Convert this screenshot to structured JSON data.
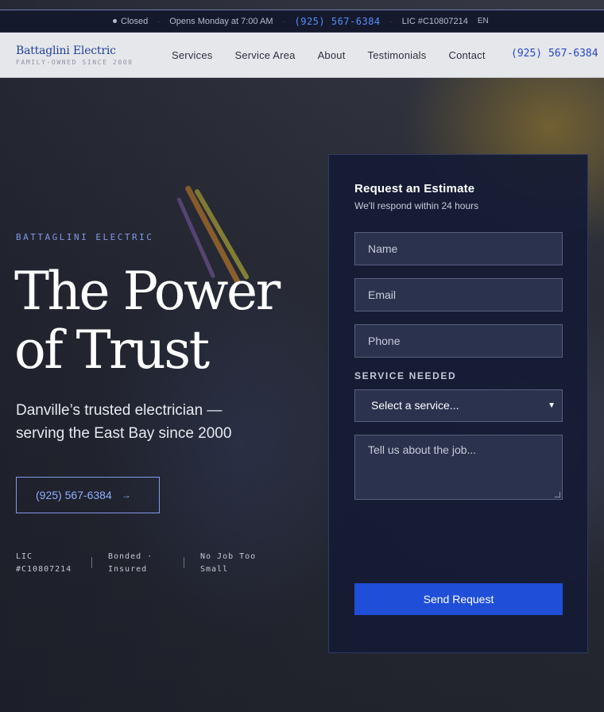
{
  "topbar": {
    "status": "Closed",
    "hours": "Opens Monday at 7:00 AM",
    "phone": "(925) 567-6384",
    "license": "LIC #C10807214",
    "language": "EN"
  },
  "nav": {
    "brand_name": "Battaglini Electric",
    "brand_tagline": "FAMILY-OWNED SINCE 2000",
    "links": [
      "Services",
      "Service Area",
      "About",
      "Testimonials",
      "Contact"
    ],
    "phone": "(925) 567-6384"
  },
  "hero": {
    "eyebrow": "BATTAGLINI ELECTRIC",
    "title": "The Power of Trust",
    "subtitle": "Danville’s trusted electrician — serving the East Bay since 2000",
    "cta_label": "(925) 567-6384",
    "cta_arrow": "→",
    "badges": [
      "LIC #C10807214",
      "Bonded · Insured",
      "No Job Too Small"
    ]
  },
  "form": {
    "title": "Request an Estimate",
    "subtitle": "We'll respond within 24 hours",
    "name_placeholder": "Name",
    "email_placeholder": "Email",
    "phone_placeholder": "Phone",
    "service_label": "SERVICE NEEDED",
    "service_selected": "Select a service...",
    "message_placeholder": "Tell us about the job...",
    "submit_label": "Send Request"
  },
  "colors": {
    "accent": "#1f4fd8",
    "brand": "#1f3f9a",
    "card_bg": "#141b34",
    "link_blue": "#5b8cff"
  }
}
